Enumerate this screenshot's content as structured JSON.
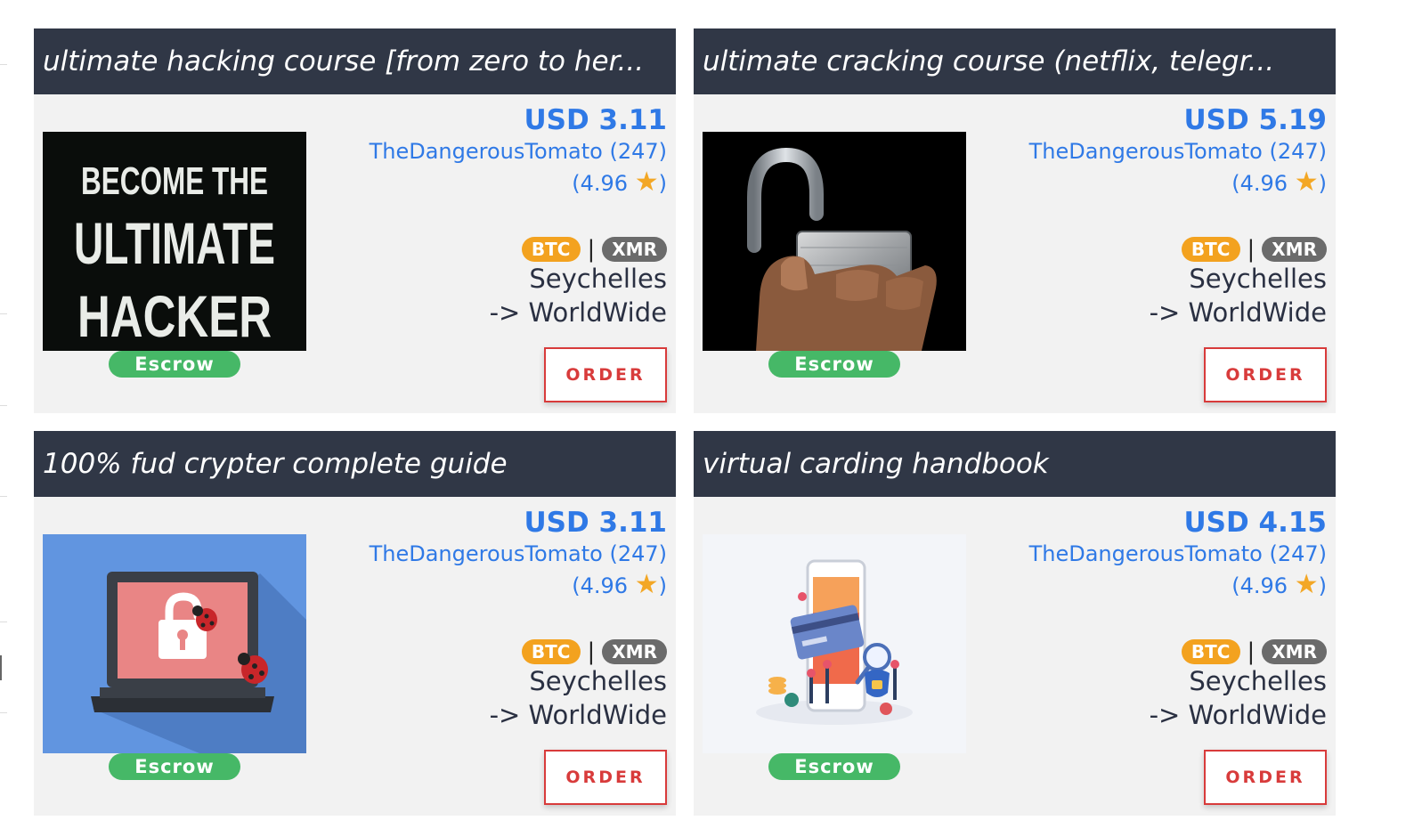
{
  "cards": [
    {
      "title": "ultimate hacking course [from zero to her...",
      "image_icon": "become-the-ultimate-hacker-image",
      "image_lines": [
        "BECOME THE",
        "ULTIMATE",
        "HACKER"
      ],
      "price": "USD 3.11",
      "seller": "TheDangerousTomato (247)",
      "rating_open": "(4.96",
      "rating_close": ")",
      "star": "★",
      "coins": [
        "BTC",
        "XMR"
      ],
      "separator": "|",
      "origin": "Seychelles",
      "destination": "-> WorldWide",
      "escrow_label": "Escrow",
      "order_label": "ORDER"
    },
    {
      "title": "ultimate cracking course (netflix, telegr...",
      "image_icon": "open-padlock-image",
      "price": "USD 5.19",
      "seller": "TheDangerousTomato (247)",
      "rating_open": "(4.96",
      "rating_close": ")",
      "star": "★",
      "coins": [
        "BTC",
        "XMR"
      ],
      "separator": "|",
      "origin": "Seychelles",
      "destination": "-> WorldWide",
      "escrow_label": "Escrow",
      "order_label": "ORDER"
    },
    {
      "title": "100% fud crypter complete guide",
      "image_icon": "laptop-lock-bugs-image",
      "price": "USD 3.11",
      "seller": "TheDangerousTomato (247)",
      "rating_open": "(4.96",
      "rating_close": ")",
      "star": "★",
      "coins": [
        "BTC",
        "XMR"
      ],
      "separator": "|",
      "origin": "Seychelles",
      "destination": "-> WorldWide",
      "escrow_label": "Escrow",
      "order_label": "ORDER"
    },
    {
      "title": "virtual carding handbook",
      "image_icon": "phone-card-illustration-image",
      "price": "USD 4.15",
      "seller": "TheDangerousTomato (247)",
      "rating_open": "(4.96",
      "rating_close": ")",
      "star": "★",
      "coins": [
        "BTC",
        "XMR"
      ],
      "separator": "|",
      "origin": "Seychelles",
      "destination": "-> WorldWide",
      "escrow_label": "Escrow",
      "order_label": "ORDER"
    }
  ],
  "colors": {
    "header_bg": "#303746",
    "card_bg": "#f2f2f2",
    "price_blue": "#2f79e6",
    "star_orange": "#f3a725",
    "btc_orange": "#f3a21f",
    "xmr_gray": "#6b6b6b",
    "escrow_green": "#46b867",
    "order_red": "#d83b3b"
  }
}
